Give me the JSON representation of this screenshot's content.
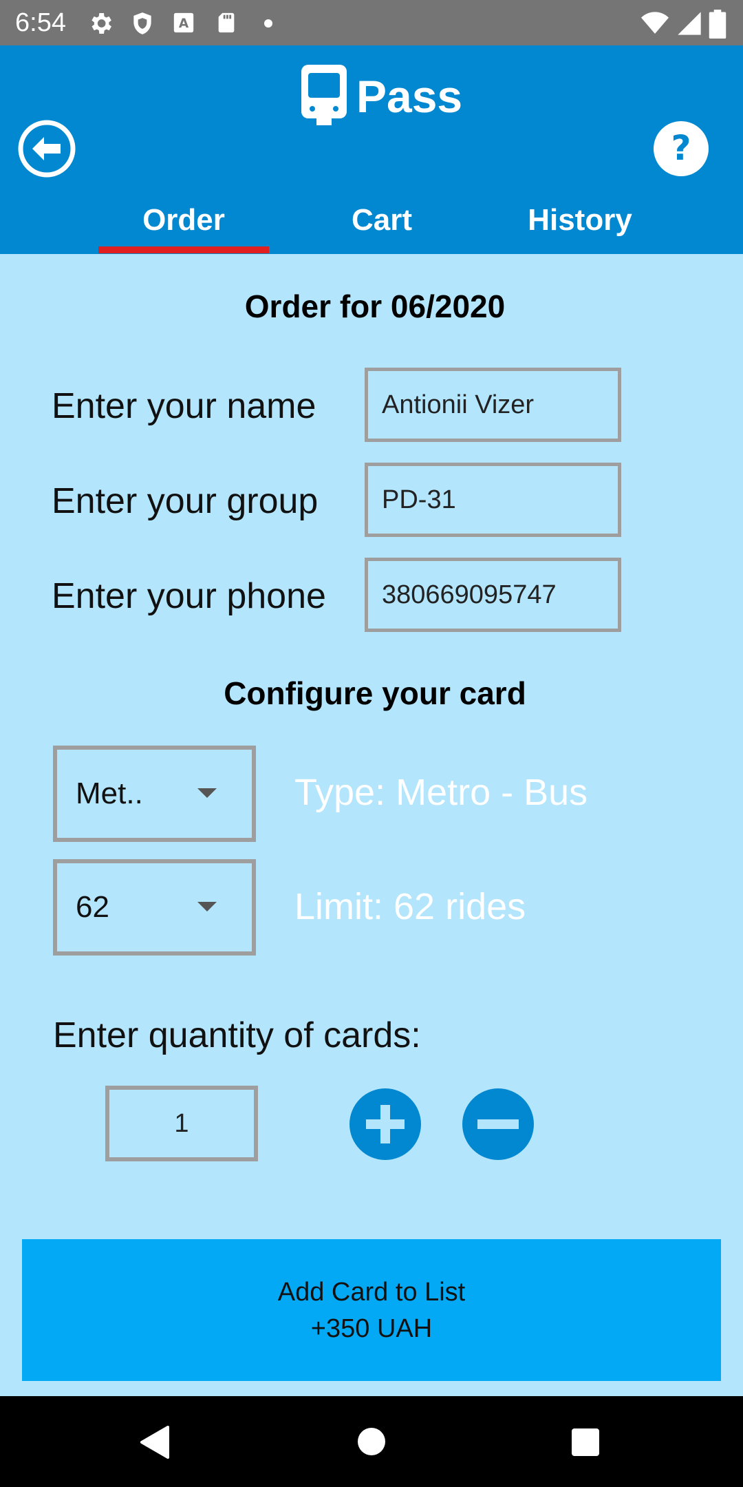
{
  "status_bar": {
    "time": "6:54",
    "icons": [
      "gear-icon",
      "shield-icon",
      "a-icon",
      "sd-card-icon",
      "dot-icon",
      "wifi-icon",
      "signal-icon",
      "battery-icon"
    ],
    "background": "#757575"
  },
  "app_bar": {
    "title": "Pass",
    "logo_icon": "bus-icon",
    "back_icon": "back-arrow-icon",
    "help_icon": "help-icon",
    "background": "#0288D1"
  },
  "tabs": [
    {
      "label": "Order",
      "selected": true
    },
    {
      "label": "Cart",
      "selected": false
    },
    {
      "label": "History",
      "selected": false
    }
  ],
  "tab_indicator_color": "#E02020",
  "order": {
    "title": "Order for 06/2020",
    "name_label": "Enter your name",
    "name_value": "Antionii Vizer",
    "group_label": "Enter your group",
    "group_value": "PD-31",
    "phone_label": "Enter your phone",
    "phone_value": "380669095747"
  },
  "card": {
    "title": "Configure your card",
    "type_dropdown_value": "Met..",
    "type_text": "Type: Metro - Bus",
    "limit_dropdown_value": "62",
    "limit_text": "Limit: 62 rides"
  },
  "quantity": {
    "label": "Enter quantity of cards:",
    "value": "1",
    "plus_icon": "plus-icon",
    "minus_icon": "minus-icon"
  },
  "add_button": {
    "line1": "Add Card to List",
    "line2": "+350 UAH",
    "background": "#03A9F4"
  },
  "nav_bar": {
    "icons": [
      "back-triangle-icon",
      "home-circle-icon",
      "recents-square-icon"
    ]
  }
}
